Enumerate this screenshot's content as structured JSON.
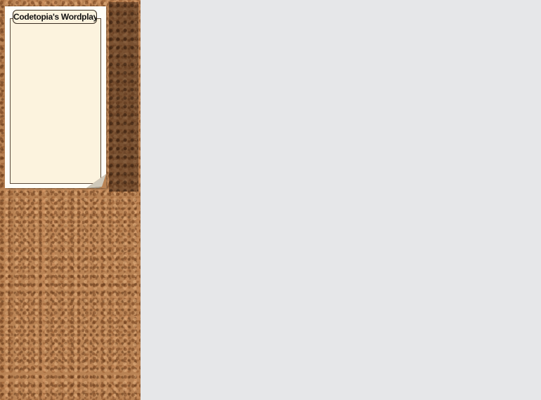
{
  "sidebar": {
    "note": {
      "title": "Codetopia's Wordplay"
    }
  },
  "colors": {
    "cork": "#b98354",
    "paper": "#fffef8",
    "note_fill": "#fcf3de",
    "background": "#e6e7e9"
  }
}
